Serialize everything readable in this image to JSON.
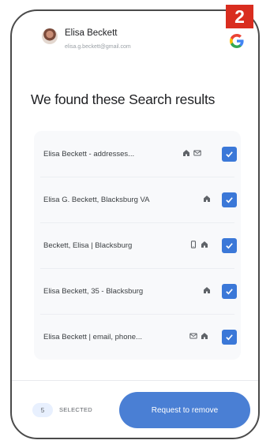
{
  "step_badge": "2",
  "account": {
    "name": "Elisa Beckett",
    "email": "elisa.g.beckett@gmail.com"
  },
  "icons": {
    "google": "google-g-icon",
    "home": "home-icon",
    "mail": "mail-icon",
    "phone": "phone-icon",
    "check": "check-icon"
  },
  "heading": "We found these Search results",
  "results": [
    {
      "label": "Elisa Beckett - addresses...",
      "icons": [
        "home-icon",
        "mail-icon"
      ],
      "checked": true
    },
    {
      "label": "Elisa G. Beckett, Blacksburg VA",
      "icons": [
        "home-icon"
      ],
      "checked": true
    },
    {
      "label": "Beckett, Elisa | Blacksburg",
      "icons": [
        "phone-icon",
        "home-icon"
      ],
      "checked": true
    },
    {
      "label": "Elisa Beckett, 35 - Blacksburg",
      "icons": [
        "home-icon"
      ],
      "checked": true
    },
    {
      "label": "Elisa Beckett | email, phone...",
      "icons": [
        "mail-icon",
        "home-icon"
      ],
      "checked": true
    }
  ],
  "footer": {
    "count": "5",
    "selected_label": "SELECTED",
    "button_label": "Request to remove"
  },
  "colors": {
    "accent": "#3b78d8",
    "button": "#4a7fd4",
    "badge": "#d92d1f"
  }
}
